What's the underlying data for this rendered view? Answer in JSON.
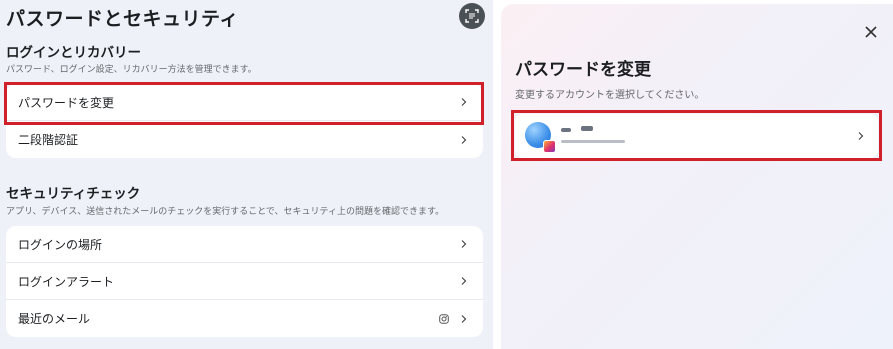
{
  "left": {
    "title": "パスワードとセキュリティ",
    "login_section": {
      "title": "ログインとリカバリー",
      "description": "パスワード、ログイン設定、リカバリー方法を管理できます。",
      "items": [
        {
          "label": "パスワードを変更"
        },
        {
          "label": "二段階認証"
        }
      ]
    },
    "security_section": {
      "title": "セキュリティチェック",
      "description": "アプリ、デバイス、送信されたメールのチェックを実行することで、セキュリティ上の問題を確認できます。",
      "items": [
        {
          "label": "ログインの場所"
        },
        {
          "label": "ログインアラート"
        },
        {
          "label": "最近のメール",
          "icon": "instagram-icon"
        }
      ]
    },
    "highlight_color": "#d0212a"
  },
  "modal": {
    "title": "パスワードを変更",
    "description": "変更するアカウントを選択してください。",
    "account_icon": "instagram-icon"
  },
  "icons": {
    "scan": "scan-text-icon",
    "close": "close-icon",
    "chevron": "chevron-right-icon"
  }
}
